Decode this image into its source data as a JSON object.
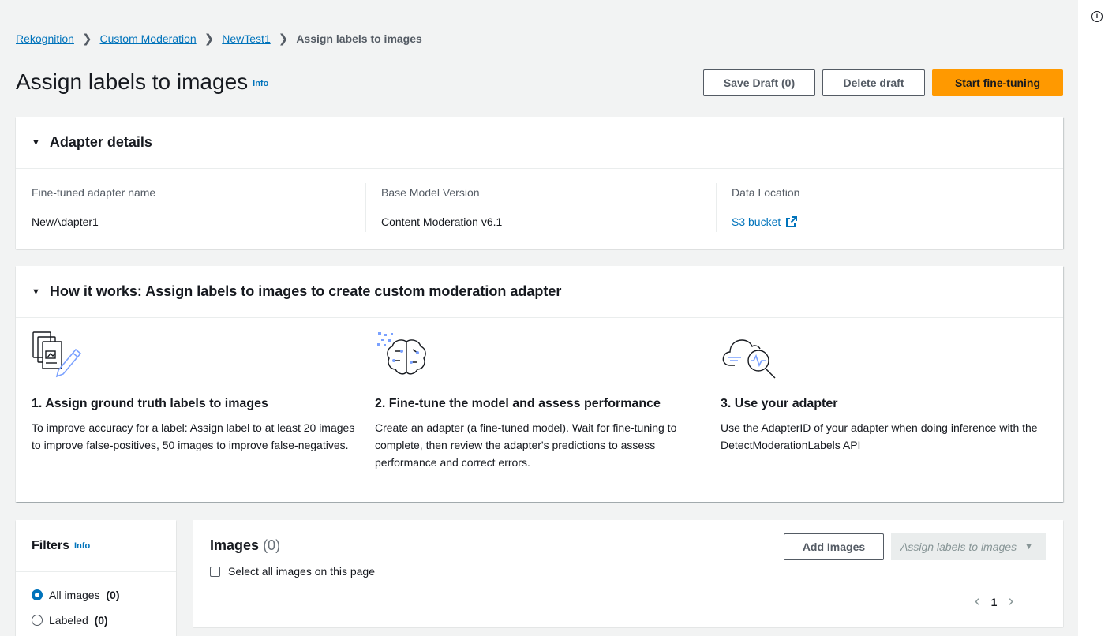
{
  "breadcrumb": {
    "items": [
      "Rekognition",
      "Custom Moderation",
      "NewTest1"
    ],
    "current": "Assign labels to images"
  },
  "header": {
    "title": "Assign labels to images",
    "info": "Info",
    "save_draft": "Save Draft (0)",
    "delete_draft": "Delete draft",
    "start": "Start fine-tuning"
  },
  "adapter": {
    "title": "Adapter details",
    "name_label": "Fine-tuned adapter name",
    "name_value": "NewAdapter1",
    "base_label": "Base Model Version",
    "base_value": "Content Moderation v6.1",
    "location_label": "Data Location",
    "location_value": "S3 bucket"
  },
  "how": {
    "title": "How it works: Assign labels to images to create custom moderation adapter",
    "steps": [
      {
        "icon": "label-documents-icon",
        "title": "1. Assign ground truth labels to images",
        "text": "To improve accuracy for a label: Assign label to at least 20 images to improve false-positives, 50 images to improve false-negatives."
      },
      {
        "icon": "brain-network-icon",
        "title": "2. Fine-tune the model and assess performance",
        "text": "Create an adapter (a fine-tuned model). Wait for fine-tuning to complete, then review the adapter's predictions to assess performance and correct errors."
      },
      {
        "icon": "cloud-search-icon",
        "title": "3. Use your adapter",
        "text": "Use the AdapterID of your adapter when doing inference with the DetectModerationLabels API"
      }
    ]
  },
  "filters": {
    "title": "Filters",
    "info": "Info",
    "options": [
      {
        "label": "All images",
        "count": "(0)",
        "selected": true
      },
      {
        "label": "Labeled",
        "count": "(0)",
        "selected": false
      }
    ]
  },
  "images": {
    "title": "Images",
    "count": "(0)",
    "select_all": "Select all images on this page",
    "add_images": "Add Images",
    "assign_dropdown": "Assign labels to images",
    "page": "1"
  },
  "colors": {
    "accent": "#0073bb",
    "primary_button": "#ff9900"
  }
}
